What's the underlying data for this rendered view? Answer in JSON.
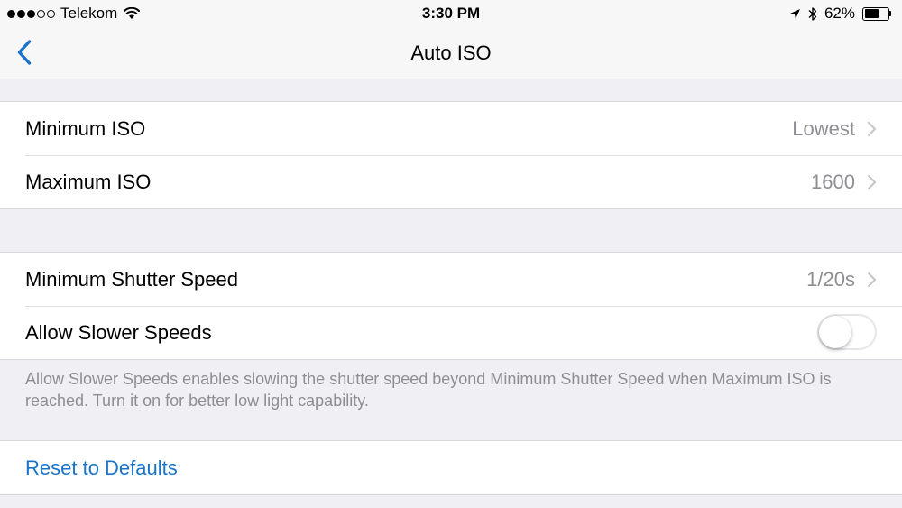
{
  "status_bar": {
    "carrier": "Telekom",
    "time": "3:30 PM",
    "battery": "62%",
    "battery_level": 0.62
  },
  "nav": {
    "title": "Auto ISO",
    "back_icon": "chevron-left-icon"
  },
  "iso_group": {
    "rows": [
      {
        "label": "Minimum ISO",
        "value": "Lowest"
      },
      {
        "label": "Maximum ISO",
        "value": "1600"
      }
    ]
  },
  "shutter_group": {
    "rows": [
      {
        "label": "Minimum Shutter Speed",
        "value": "1/20s"
      },
      {
        "label": "Allow Slower Speeds",
        "toggle_on": false
      }
    ],
    "footer": "Allow Slower Speeds enables slowing the shutter speed beyond Minimum Shutter Speed when Maximum ISO is reached. Turn it on for better low light capability."
  },
  "reset": {
    "label": "Reset to Defaults"
  },
  "colors": {
    "accent": "#1a73c8",
    "background": "#efeff4",
    "secondary_text": "#8e8e93"
  }
}
